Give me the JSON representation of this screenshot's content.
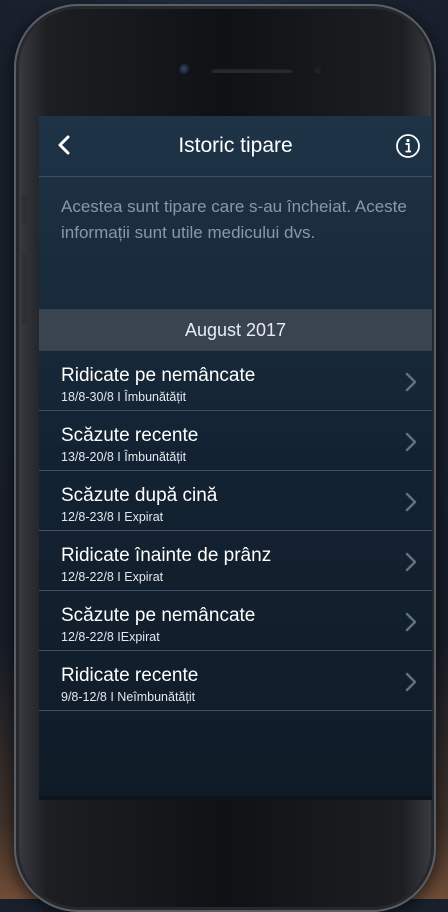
{
  "nav": {
    "title": "Istoric tipare",
    "back_icon": "chevron-left-icon",
    "info_icon": "info-icon"
  },
  "description": "Acestea sunt tipare care s-au încheiat. Aceste informații sunt utile medicului dvs.",
  "section": {
    "header": "August 2017"
  },
  "patterns": [
    {
      "title": "Ridicate pe nemâncate",
      "subtitle": "18/8-30/8  I  Îmbunătățit"
    },
    {
      "title": "Scăzute recente",
      "subtitle": "13/8-20/8  I  Îmbunătățit"
    },
    {
      "title": "Scăzute după cină",
      "subtitle": "12/8-23/8  I  Expirat"
    },
    {
      "title": "Ridicate înainte de prânz",
      "subtitle": "12/8-22/8  I  Expirat"
    },
    {
      "title": "Scăzute pe nemâncate",
      "subtitle": "12/8-22/8  IExpirat"
    },
    {
      "title": "Ridicate recente",
      "subtitle": "9/8-12/8  I  Neîmbunătățit"
    }
  ],
  "colors": {
    "text_primary": "#ffffff",
    "text_secondary": "#8699ab",
    "section_bg": "#3a4450",
    "divider": "#3d5064",
    "chevron": "#5f7082"
  }
}
